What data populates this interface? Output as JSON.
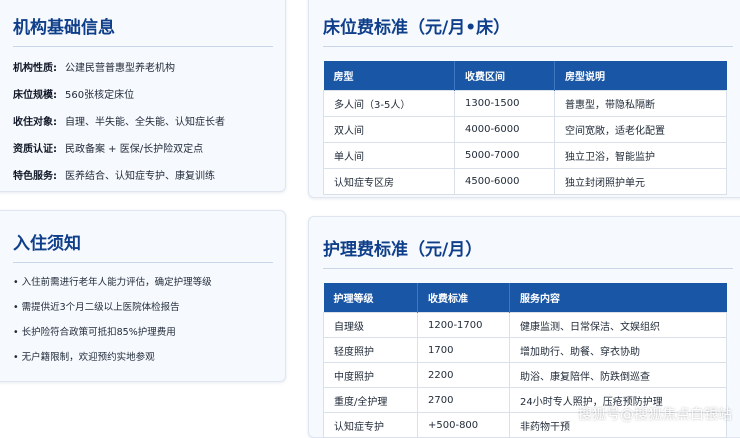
{
  "basic": {
    "title": "机构基础信息",
    "items": [
      {
        "key": "机构性质:",
        "value": "公建民营普惠型养老机构"
      },
      {
        "key": "床位规模:",
        "value": "560张核定床位"
      },
      {
        "key": "收住对象:",
        "value": "自理、半失能、全失能、认知症长者"
      },
      {
        "key": "资质认证:",
        "value": "民政备案 + 医保/长护险双定点"
      },
      {
        "key": "特色服务:",
        "value": "医养结合、认知症专护、康复训练"
      }
    ]
  },
  "notice": {
    "title": "入住须知",
    "items": [
      "• 入住前需进行老年人能力评估，确定护理等级",
      "• 需提供近3个月二级以上医院体检报告",
      "• 长护险符合政策可抵扣85%护理费用",
      "• 无户籍限制，欢迎预约实地参观"
    ]
  },
  "bed": {
    "title": "床位费标准（元/月•床）",
    "headers": [
      "房型",
      "收费区间",
      "房型说明"
    ],
    "rows": [
      [
        "多人间（3-5人）",
        "1300-1500",
        "普惠型，带隐私隔断"
      ],
      [
        "双人间",
        "4000-6000",
        "空间宽敞，适老化配置"
      ],
      [
        "单人间",
        "5000-7000",
        "独立卫浴，智能监护"
      ],
      [
        "认知症专区房",
        "4500-6000",
        "独立封闭照护单元"
      ]
    ]
  },
  "care": {
    "title": "护理费标准（元/月）",
    "headers": [
      "护理等级",
      "收费标准",
      "服务内容"
    ],
    "rows": [
      [
        "自理级",
        "1200-1700",
        "健康监测、日常保洁、文娱组织"
      ],
      [
        "轻度照护",
        "1700",
        "增加助行、助餐、穿衣协助"
      ],
      [
        "中度照护",
        "2200",
        "助浴、康复陪伴、防跌倒巡查"
      ],
      [
        "重度/全护理",
        "2700",
        "24小时专人照护，压疮预防护理"
      ],
      [
        "认知症专护",
        "+500-800",
        "非药物干预"
      ]
    ]
  },
  "watermark": "搜狐号@搜狐焦点白银站"
}
